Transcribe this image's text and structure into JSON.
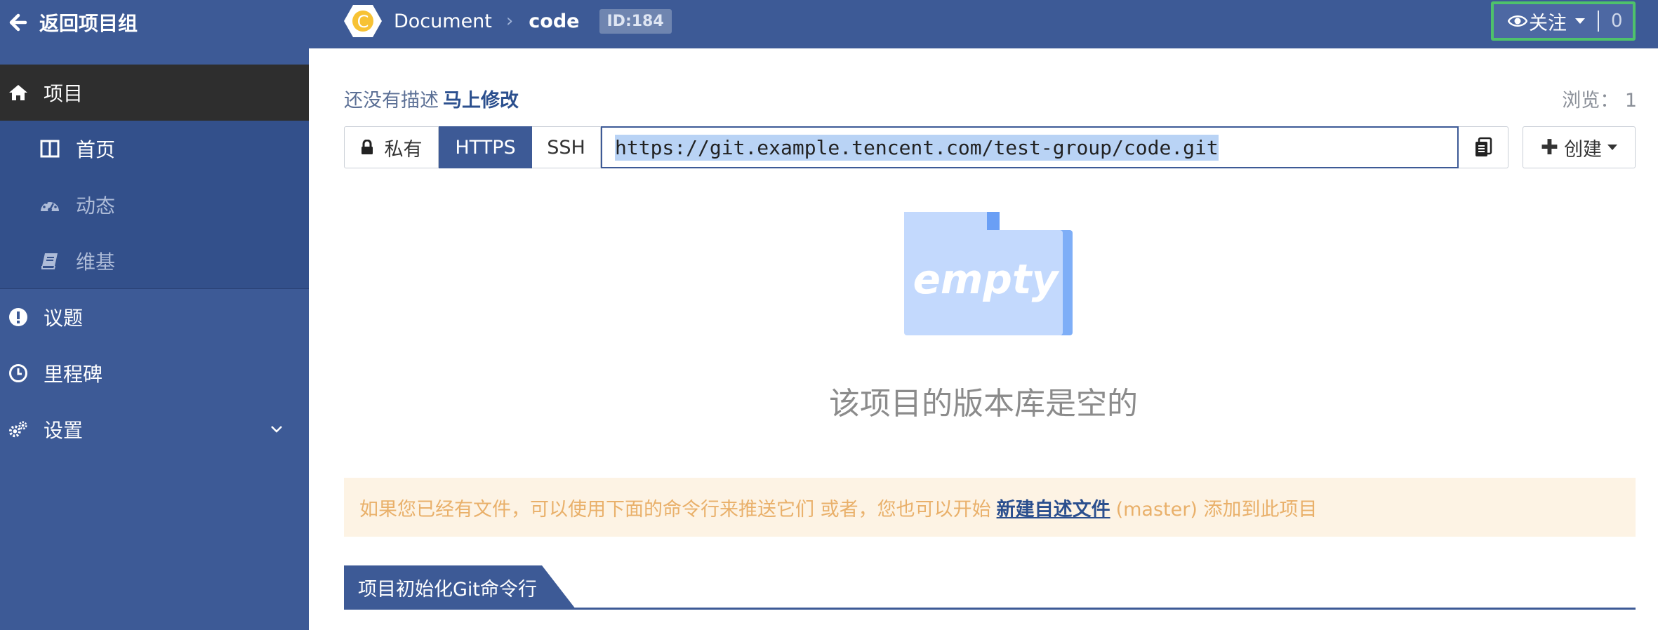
{
  "topbar": {
    "back_label": "返回项目组",
    "project_initial": "C",
    "crumb_group": "Document",
    "crumb_separator": "›",
    "crumb_repo": "code",
    "id_badge": "ID:184",
    "watch_label": "关注",
    "watch_count": "0"
  },
  "sidebar": {
    "project": "项目",
    "home": "首页",
    "activity": "动态",
    "wiki": "维基",
    "issues": "议题",
    "milestones": "里程碑",
    "settings": "设置"
  },
  "main": {
    "no_desc": "还没有描述",
    "edit_now": "马上修改",
    "views_label": "浏览：",
    "views_count": "1",
    "private_label": "私有",
    "https_label": "HTTPS",
    "ssh_label": "SSH",
    "repo_url": "https://git.example.tencent.com/test-group/code.git",
    "create_label": "创建",
    "empty_illus_text": "empty",
    "empty_title": "该项目的版本库是空的",
    "notice_prefix": "如果您已经有文件，可以使用下面的命令行来推送它们 或者，您也可以开始",
    "notice_link": "新建自述文件",
    "notice_suffix": "(master) 添加到此项目",
    "section_title": "项目初始化Git命令行"
  },
  "colors": {
    "brand": "#3d5a96",
    "sidebar_active": "#2e2e2e",
    "notice_bg": "#fdf3e4",
    "notice_text": "#e9b06a",
    "watch_border": "#4ec26b",
    "hex_badge": "#f7c234"
  },
  "icons": [
    "arrow-left-icon",
    "hexagon-badge-icon",
    "eye-icon",
    "home-icon",
    "columns-icon",
    "dashboard-icon",
    "book-icon",
    "exclamation-circle-icon",
    "clock-icon",
    "gears-icon",
    "chevron-down-icon",
    "lock-icon",
    "clipboard-icon",
    "plus-icon",
    "empty-folder-icon"
  ]
}
